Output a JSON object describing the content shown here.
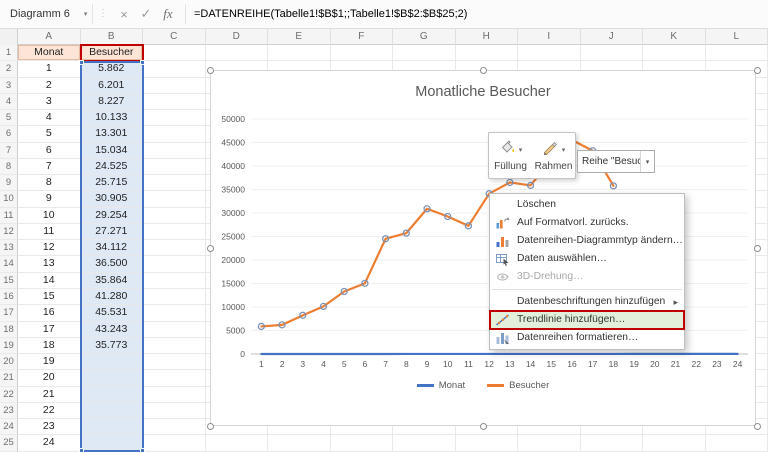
{
  "formula_bar": {
    "name_box": "Diagramm 6",
    "cancel_label": "×",
    "enter_label": "✓",
    "fx_label": "fx",
    "formula": "=DATENREIHE(Tabelle1!$B$1;;Tabelle1!$B$2:$B$25;2)"
  },
  "grid": {
    "column_headers": [
      "A",
      "B",
      "C",
      "D",
      "E",
      "F",
      "G",
      "H",
      "I",
      "J",
      "K",
      "L"
    ],
    "rows": [
      {
        "n": "1",
        "a": "Monat",
        "b": "Besucher",
        "h": true
      },
      {
        "n": "2",
        "a": "1",
        "b": "5.862"
      },
      {
        "n": "3",
        "a": "2",
        "b": "6.201"
      },
      {
        "n": "4",
        "a": "3",
        "b": "8.227"
      },
      {
        "n": "5",
        "a": "4",
        "b": "10.133"
      },
      {
        "n": "6",
        "a": "5",
        "b": "13.301"
      },
      {
        "n": "7",
        "a": "6",
        "b": "15.034"
      },
      {
        "n": "8",
        "a": "7",
        "b": "24.525"
      },
      {
        "n": "9",
        "a": "8",
        "b": "25.715"
      },
      {
        "n": "10",
        "a": "9",
        "b": "30.905"
      },
      {
        "n": "11",
        "a": "10",
        "b": "29.254"
      },
      {
        "n": "12",
        "a": "11",
        "b": "27.271"
      },
      {
        "n": "13",
        "a": "12",
        "b": "34.112"
      },
      {
        "n": "14",
        "a": "13",
        "b": "36.500"
      },
      {
        "n": "15",
        "a": "14",
        "b": "35.864"
      },
      {
        "n": "16",
        "a": "15",
        "b": "41.280"
      },
      {
        "n": "17",
        "a": "16",
        "b": "45.531"
      },
      {
        "n": "18",
        "a": "17",
        "b": "43.243"
      },
      {
        "n": "19",
        "a": "18",
        "b": "35.773"
      },
      {
        "n": "20",
        "a": "19",
        "b": ""
      },
      {
        "n": "21",
        "a": "20",
        "b": ""
      },
      {
        "n": "22",
        "a": "21",
        "b": ""
      },
      {
        "n": "23",
        "a": "22",
        "b": ""
      },
      {
        "n": "24",
        "a": "23",
        "b": ""
      },
      {
        "n": "25",
        "a": "24",
        "b": ""
      }
    ]
  },
  "mini_toolbar": {
    "fill_label": "Füllung",
    "border_label": "Rahmen",
    "fill_icon": "paint-bucket-icon",
    "border_icon": "border-pen-icon",
    "series_selector": "Reihe \"Besuch..."
  },
  "context_menu": {
    "highlight_color": "#E2EFDA",
    "annotation_color": "#C00000",
    "items": [
      {
        "name": "delete",
        "label": "Löschen"
      },
      {
        "name": "reset-style",
        "label": "Auf Formatvorl. zurücks.",
        "icon": "reset-style-icon"
      },
      {
        "name": "change-chart-type",
        "label": "Datenreihen-Diagrammtyp ändern…",
        "icon": "change-chart-type-icon"
      },
      {
        "name": "select-data",
        "label": "Daten auswählen…",
        "icon": "select-data-icon"
      },
      {
        "name": "3d-rotation",
        "label": "3D-Drehung…",
        "icon": "rotation-3d-icon",
        "disabled": true
      },
      {
        "separator": true
      },
      {
        "name": "add-data-labels",
        "label": "Datenbeschriftungen hinzufügen",
        "submenu": true
      },
      {
        "name": "add-trendline",
        "label": "Trendlinie hinzufügen…",
        "icon": "trendline-icon",
        "highlighted": true,
        "annotated": true
      },
      {
        "name": "format-series",
        "label": "Datenreihen formatieren…",
        "icon": "format-series-icon"
      }
    ]
  },
  "chart_data": {
    "type": "line",
    "title": "Monatliche Besucher",
    "x": [
      1,
      2,
      3,
      4,
      5,
      6,
      7,
      8,
      9,
      10,
      11,
      12,
      13,
      14,
      15,
      16,
      17,
      18,
      19,
      20,
      21,
      22,
      23,
      24
    ],
    "ylim": [
      0,
      50000
    ],
    "yticks": [
      0,
      5000,
      10000,
      15000,
      20000,
      25000,
      30000,
      35000,
      40000,
      45000,
      50000
    ],
    "grid": true,
    "legend_position": "bottom",
    "selected_series": "Besucher",
    "series": [
      {
        "name": "Monat",
        "color": "#4472C4",
        "markers": false,
        "values": [
          1,
          2,
          3,
          4,
          5,
          6,
          7,
          8,
          9,
          10,
          11,
          12,
          13,
          14,
          15,
          16,
          17,
          18,
          19,
          20,
          21,
          22,
          23,
          24
        ]
      },
      {
        "name": "Besucher",
        "color": "#ED7D31",
        "markers": true,
        "values": [
          5862,
          6201,
          8227,
          10133,
          13301,
          15034,
          24525,
          25715,
          30905,
          29254,
          27271,
          34112,
          36500,
          35864,
          41280,
          45531,
          43243,
          35773,
          null,
          null,
          null,
          null,
          null,
          null
        ]
      }
    ]
  }
}
